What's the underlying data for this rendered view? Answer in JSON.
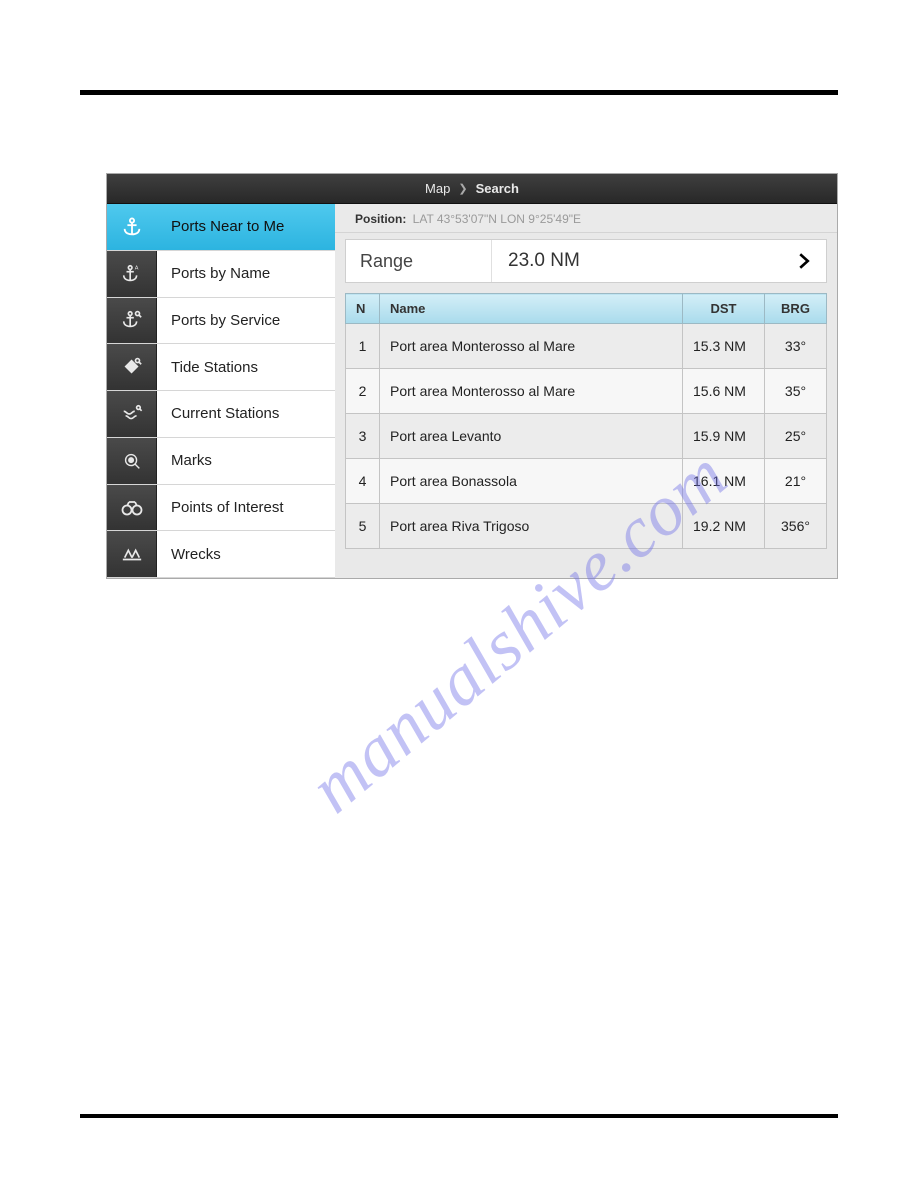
{
  "breadcrumb": {
    "root": "Map",
    "current": "Search"
  },
  "sidebar": {
    "items": [
      {
        "label": "Ports Near to Me",
        "icon": "anchor"
      },
      {
        "label": "Ports by Name",
        "icon": "anchor-az"
      },
      {
        "label": "Ports by Service",
        "icon": "anchor-search"
      },
      {
        "label": "Tide Stations",
        "icon": "diamond-search"
      },
      {
        "label": "Current Stations",
        "icon": "currents"
      },
      {
        "label": "Marks",
        "icon": "mark"
      },
      {
        "label": "Points of Interest",
        "icon": "binoculars"
      },
      {
        "label": "Wrecks",
        "icon": "wreck"
      }
    ],
    "active_index": 0
  },
  "position": {
    "label": "Position:",
    "value": "LAT 43°53'07\"N LON 9°25'49\"E"
  },
  "range": {
    "label": "Range",
    "value": "23.0 NM"
  },
  "table": {
    "headers": {
      "n": "N",
      "name": "Name",
      "dst": "DST",
      "brg": "BRG"
    },
    "rows": [
      {
        "n": "1",
        "name": "Port area Monterosso al Mare",
        "dst": "15.3 NM",
        "brg": "33°"
      },
      {
        "n": "2",
        "name": "Port area Monterosso al Mare",
        "dst": "15.6 NM",
        "brg": "35°"
      },
      {
        "n": "3",
        "name": "Port area Levanto",
        "dst": "15.9 NM",
        "brg": "25°"
      },
      {
        "n": "4",
        "name": "Port area Bonassola",
        "dst": "16.1 NM",
        "brg": "21°"
      },
      {
        "n": "5",
        "name": "Port area Riva Trigoso",
        "dst": "19.2 NM",
        "brg": "356°"
      }
    ]
  },
  "watermark": "manualshive.com"
}
